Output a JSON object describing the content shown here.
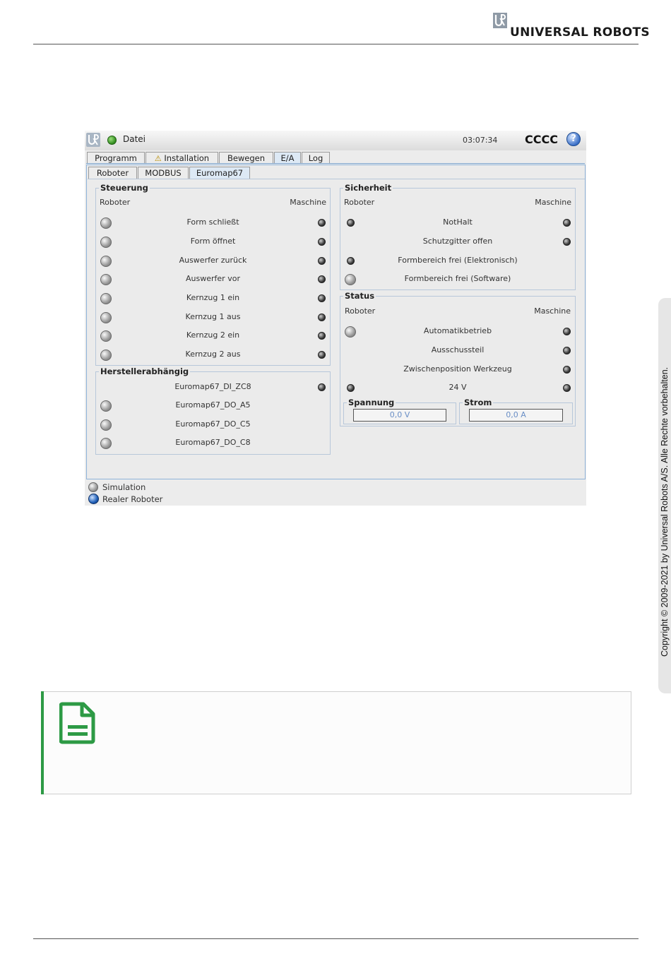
{
  "page": {
    "brand": "UNIVERSAL ROBOTS",
    "copyright": "Copyright © 2009-2021 by Universal Robots A/S. Alle Rechte vorbehalten."
  },
  "titlebar": {
    "menu": "Datei",
    "time": "03:07:34",
    "robot_name": "CCCC"
  },
  "main_tabs": [
    "Programm",
    "Installation",
    "Bewegen",
    "E/A",
    "Log"
  ],
  "sub_tabs": [
    "Roboter",
    "MODBUS",
    "Euromap67"
  ],
  "steuerung": {
    "title": "Steuerung",
    "robot_head": "Roboter",
    "machine_head": "Maschine",
    "rows": [
      "Form schließt",
      "Form öffnet",
      "Auswerfer zurück",
      "Auswerfer vor",
      "Kernzug 1 ein",
      "Kernzug 1 aus",
      "Kernzug 2 ein",
      "Kernzug 2 aus"
    ]
  },
  "hersteller": {
    "title": "Herstellerabhängig",
    "rows": [
      "Euromap67_DI_ZC8",
      "Euromap67_DO_A5",
      "Euromap67_DO_C5",
      "Euromap67_DO_C8"
    ]
  },
  "sicherheit": {
    "title": "Sicherheit",
    "robot_head": "Roboter",
    "machine_head": "Maschine",
    "rows": [
      "NotHalt",
      "Schutzgitter offen",
      "Formbereich frei (Elektronisch)",
      "Formbereich frei (Software)"
    ]
  },
  "status": {
    "title": "Status",
    "robot_head": "Roboter",
    "machine_head": "Maschine",
    "rows": [
      "Automatikbetrieb",
      "Ausschussteil",
      "Zwischenposition Werkzeug",
      "24 V"
    ]
  },
  "spannung": {
    "title": "Spannung",
    "value": "0,0 V"
  },
  "strom": {
    "title": "Strom",
    "value": "0,0 A"
  },
  "mode": {
    "simulation": "Simulation",
    "real": "Realer Roboter"
  },
  "colors": {
    "accent": "#7ea6cf",
    "note_green": "#2d9a45"
  }
}
